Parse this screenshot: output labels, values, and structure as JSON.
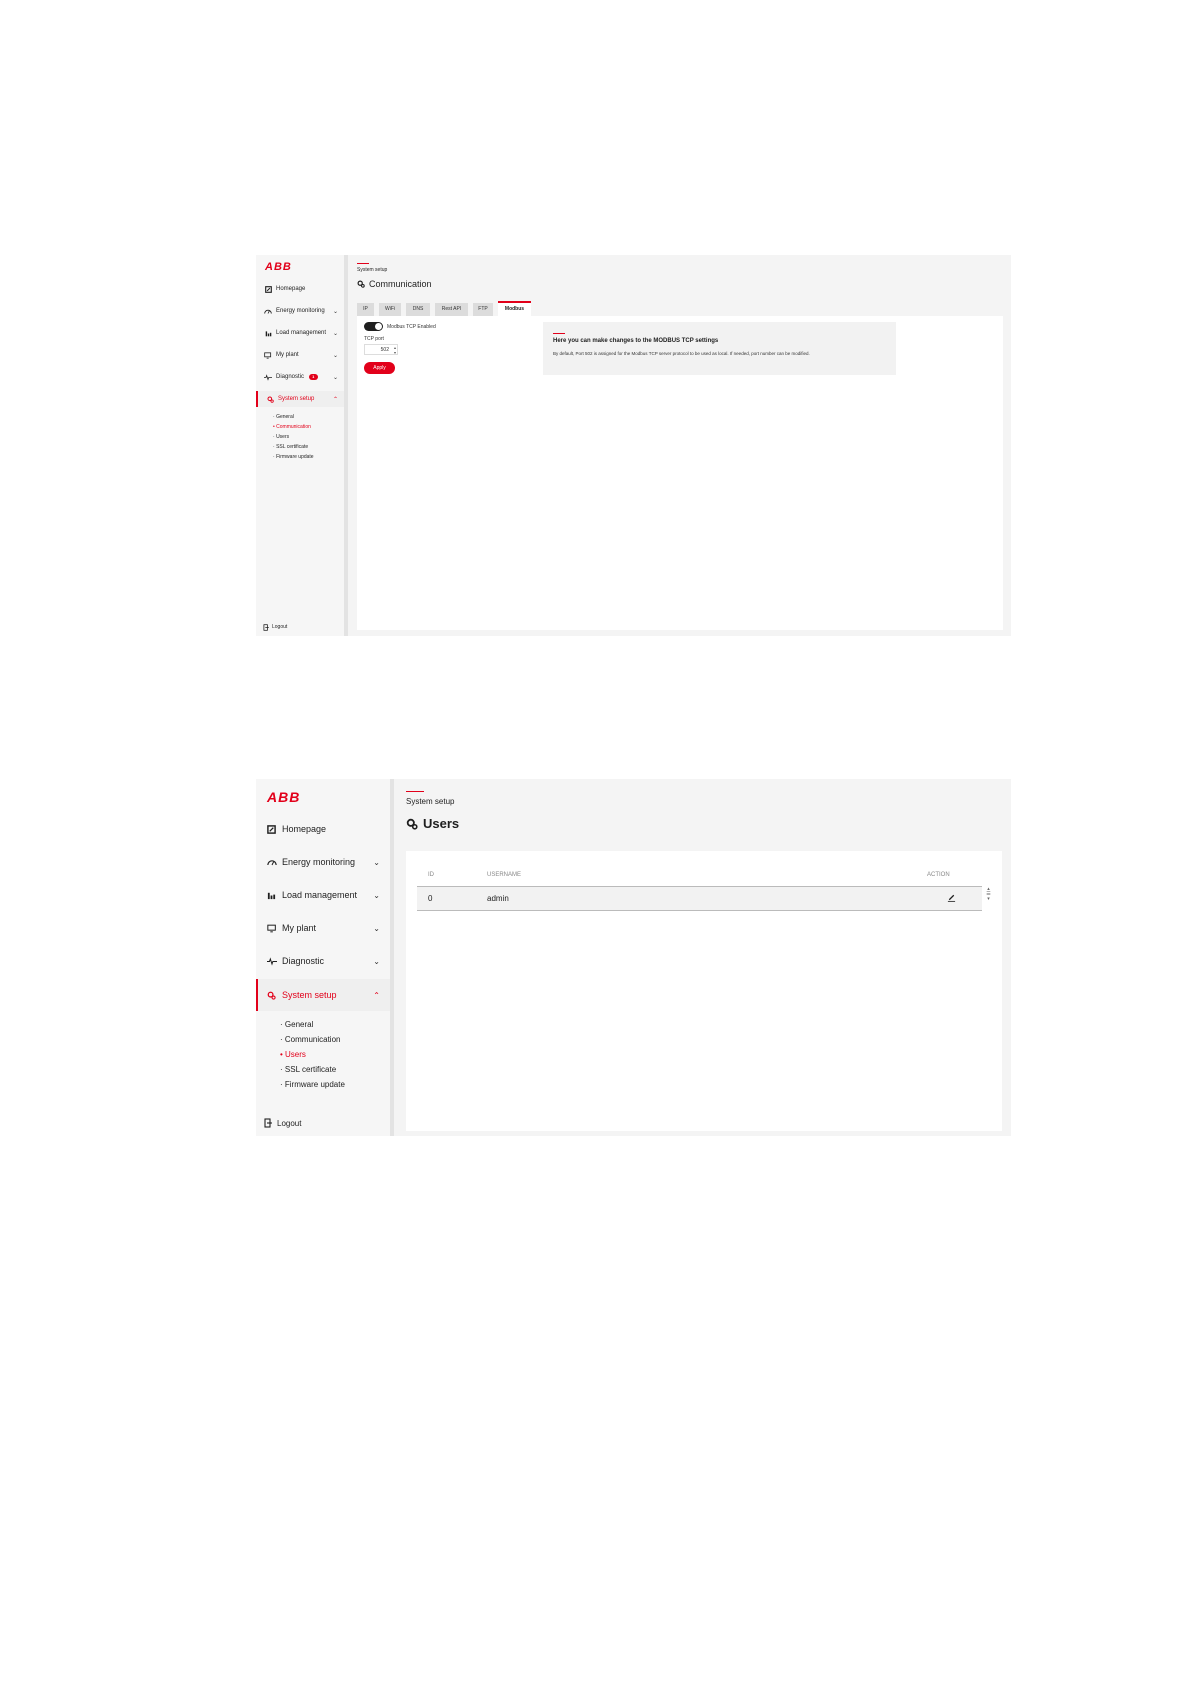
{
  "brand": {
    "logo": "ABB",
    "accent": "#e2001a"
  },
  "screen1": {
    "nav": [
      {
        "label": "Homepage",
        "icon": "homepage-icon"
      },
      {
        "label": "Energy monitoring",
        "icon": "energy-monitoring-icon"
      },
      {
        "label": "Load management",
        "icon": "load-management-icon"
      },
      {
        "label": "My plant",
        "icon": "my-plant-icon"
      },
      {
        "label": "Diagnostic",
        "icon": "diagnostic-icon",
        "badge": "1"
      },
      {
        "label": "System setup",
        "icon": "system-setup-icon"
      }
    ],
    "subnav": [
      "General",
      "Communication",
      "Users",
      "SSL certificate",
      "Firmware update"
    ],
    "active_sub": "Communication",
    "logout": "Logout",
    "breadcrumb": "System setup",
    "title": "Communication",
    "tabs": [
      "IP",
      "WiFi",
      "DNS",
      "Rest API",
      "FTP",
      "Modbus"
    ],
    "selected_tab": "Modbus",
    "toggle_label": "Modbus TCP Enabled",
    "toggle_on": true,
    "port_label": "TCP port",
    "port_value": "502",
    "apply_label": "Apply",
    "info_title": "Here you can make changes to the MODBUS TCP settings",
    "info_text": "By default, Port 502 is assigned for the Modbus TCP server protocol to be used as local. If needed, port number can be modified."
  },
  "screen2": {
    "nav": [
      {
        "label": "Homepage",
        "icon": "homepage-icon"
      },
      {
        "label": "Energy monitoring",
        "icon": "energy-monitoring-icon"
      },
      {
        "label": "Load management",
        "icon": "load-management-icon"
      },
      {
        "label": "My plant",
        "icon": "my-plant-icon"
      },
      {
        "label": "Diagnostic",
        "icon": "diagnostic-icon"
      },
      {
        "label": "System setup",
        "icon": "system-setup-icon"
      }
    ],
    "subnav": [
      "General",
      "Communication",
      "Users",
      "SSL certificate",
      "Firmware update"
    ],
    "active_sub": "Users",
    "logout": "Logout",
    "breadcrumb": "System setup",
    "title": "Users",
    "table": {
      "headers": [
        "ID",
        "USERNAME",
        "ACTION"
      ],
      "rows": [
        [
          "0",
          "admin"
        ]
      ]
    }
  }
}
